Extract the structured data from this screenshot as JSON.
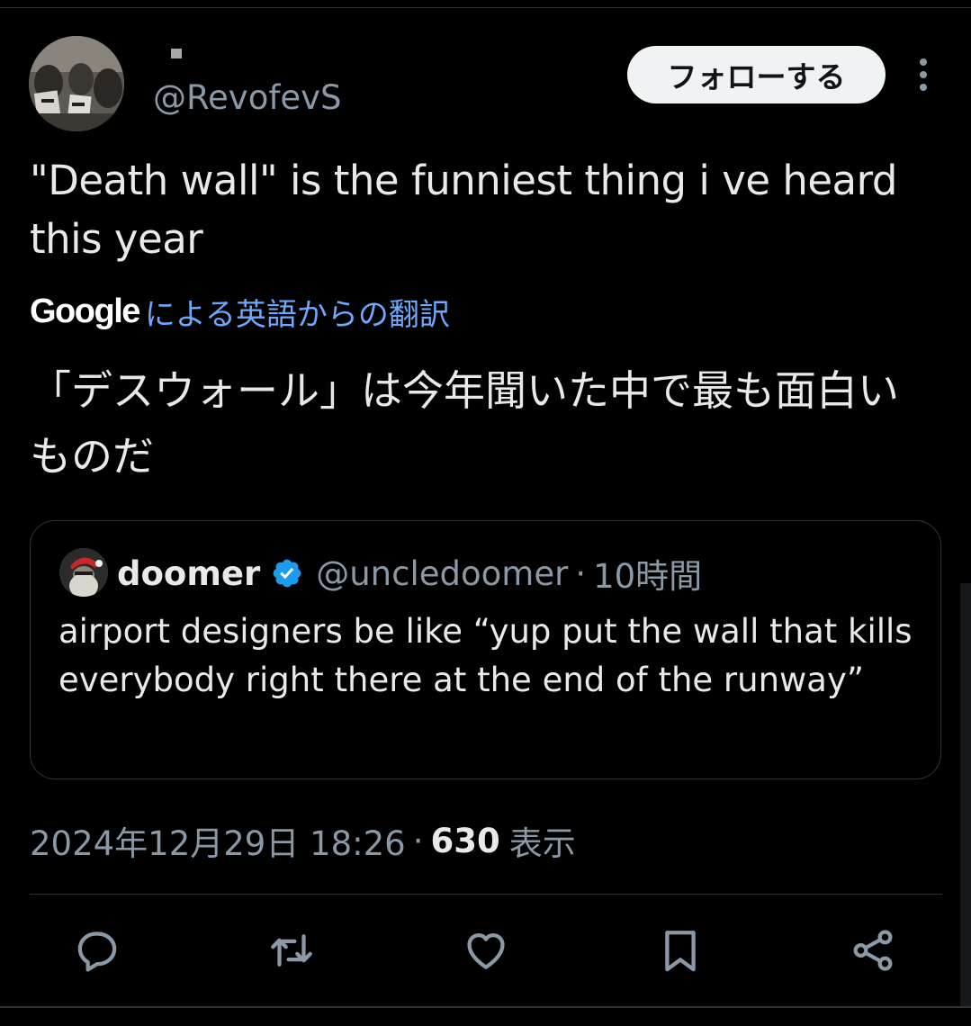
{
  "author": {
    "handle": "@RevofevS",
    "follow_label": "フォローする"
  },
  "tweet": {
    "text": "\"Death wall\" is the funniest thing i ve heard this year",
    "translation": {
      "provider": "Google",
      "link_text": "による英語からの翻訳",
      "text": "「デスウォール」は今年聞いた中で最も面白いものだ"
    },
    "timestamp": "2024年12月29日 18:26",
    "separator": "·",
    "views_count": "630",
    "views_label": "表示"
  },
  "quoted_tweet": {
    "name": "doomer",
    "verified": true,
    "handle": "@uncledoomer",
    "separator": "·",
    "time": "10時間",
    "text": "airport designers be like “yup put the wall that kills everybody right there at the end of the runway”"
  },
  "actions": [
    {
      "icon": "reply-icon"
    },
    {
      "icon": "retweet-icon"
    },
    {
      "icon": "like-icon"
    },
    {
      "icon": "bookmark-icon"
    },
    {
      "icon": "share-icon"
    }
  ],
  "colors": {
    "background": "#000000",
    "text_primary": "#e7e9ea",
    "text_secondary": "#8b98a5",
    "link": "#6ea8fe",
    "verified": "#1d9bf0",
    "border": "#2f3336",
    "follow_button_bg": "#eff3f4"
  }
}
